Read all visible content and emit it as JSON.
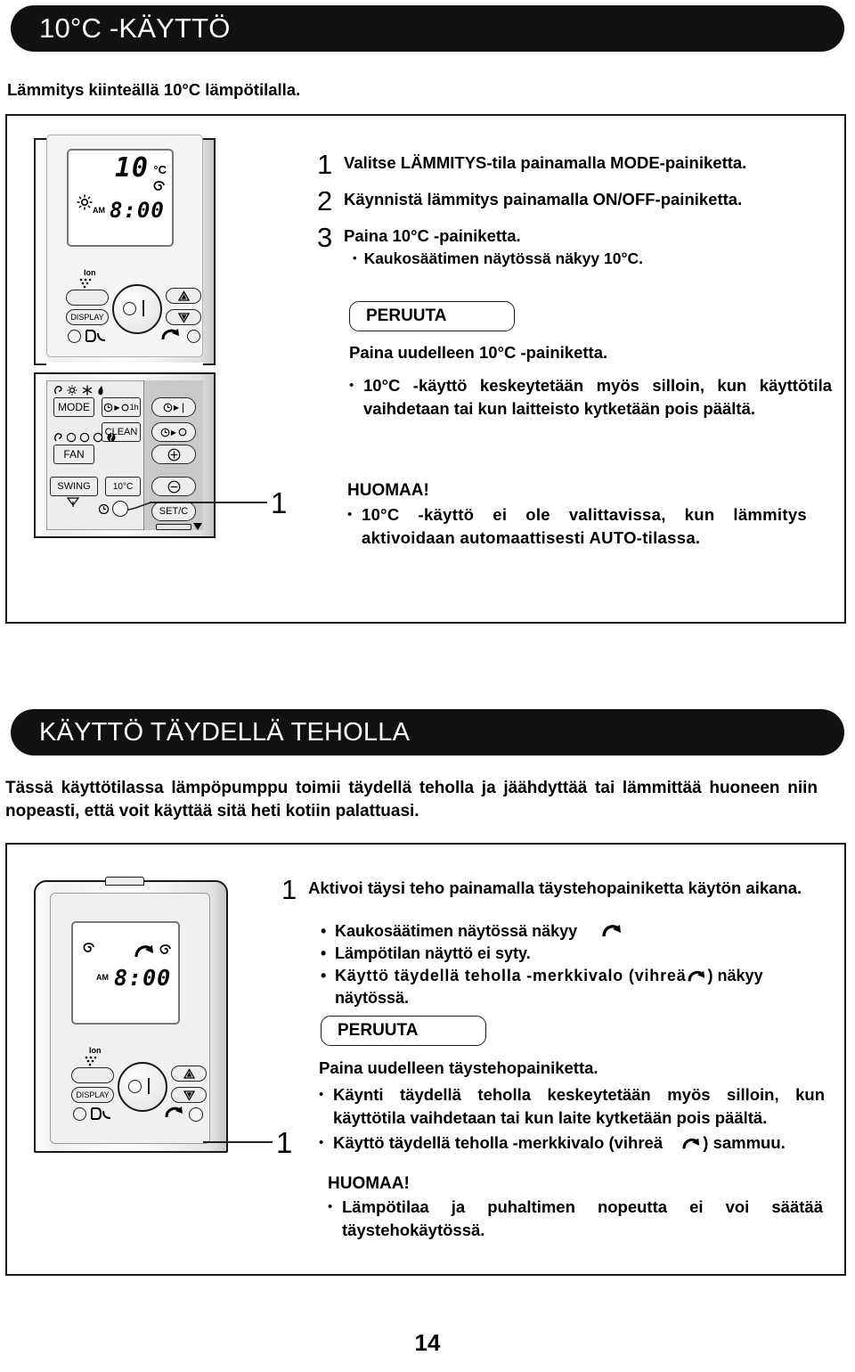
{
  "page": {
    "number": "14"
  },
  "section1": {
    "header": "10°C -KÄYTTÖ",
    "intro": "Lämmitys kiinteällä 10°C lämpötilalla.",
    "steps": [
      {
        "num": "1",
        "text": "Valitse LÄMMITYS-tila painamalla MODE-painiketta."
      },
      {
        "num": "2",
        "text": "Käynnistä lämmitys painamalla ON/OFF-painiketta."
      },
      {
        "num": "3",
        "text": "Paina 10°C -painiketta.",
        "sub": "Kaukosäätimen näytössä näkyy 10°C."
      }
    ],
    "cancel": {
      "label": "PERUUTA",
      "line": "Paina uudelleen 10°C -painiketta.",
      "bullet": "10°C -käyttö keskeytetään myös silloin, kun käyttötila vaihdetaan tai kun laitteisto kytketään pois päältä."
    },
    "note": {
      "callout_num": "1",
      "title": "HUOMAA!",
      "bullet": "10°C -käyttö ei ole valittavissa, kun lämmitys aktivoidaan automaattisesti AUTO-tilassa."
    },
    "remote": {
      "lcd": {
        "temp": "10",
        "unit": "°C",
        "ampm": "AM",
        "clock": "8:00",
        "sun_icon": "sun-icon",
        "fan-icon": "swirl-icon"
      },
      "ion_label": "Ion",
      "display_label": "DISPLAY",
      "buttons": {
        "mode": "MODE",
        "timer_1h": "1h",
        "clean": "CLEAN",
        "fan": "FAN",
        "swing": "SWING",
        "ten_c": "10°C",
        "set_c": "SET/C"
      }
    }
  },
  "section2": {
    "header": "KÄYTTÖ TÄYDELLÄ TEHOLLA",
    "intro": "Tässä käyttötilassa lämpöpumppu toimii täydellä teholla ja jäähdyttää tai lämmittää huoneen niin nopeasti, että voit käyttää sitä heti kotiin palattuasi.",
    "step": {
      "num": "1",
      "text": "Aktivoi täysi teho painamalla täystehopainiketta käytön aikana.",
      "bullets": [
        "Kaukosäätimen näytössä näkyy",
        "Lämpötilan näyttö ei syty.",
        "Käyttö täydellä teholla -merkkivalo (vihreä"
      ],
      "bullet3_tail": ") näkyy näytössä."
    },
    "cancel": {
      "label": "PERUUTA",
      "line": "Paina uudelleen täystehopainiketta.",
      "bullets": [
        "Käynti täydellä teholla keskeytetään myös silloin, kun käyttötila vaihdetaan tai kun laite kytketään pois päältä.",
        "Käyttö täydellä teholla -merkkivalo (vihreä"
      ],
      "bullet2_tail": ") sammuu."
    },
    "note": {
      "title": "HUOMAA!",
      "bullet": "Lämpötilaa ja puhaltimen nopeutta ei voi säätää täystehokäytössä."
    },
    "callout_num": "1",
    "remote": {
      "lcd": {
        "ampm": "AM",
        "clock": "8:00",
        "powerful_icon": "powerful-arrow-icon",
        "fan_icon": "swirl-icon"
      },
      "ion_label": "Ion",
      "display_label": "DISPLAY"
    }
  },
  "colors": {
    "ink": "#111111",
    "paper": "#ffffff",
    "panel": "#c9c9c9"
  }
}
